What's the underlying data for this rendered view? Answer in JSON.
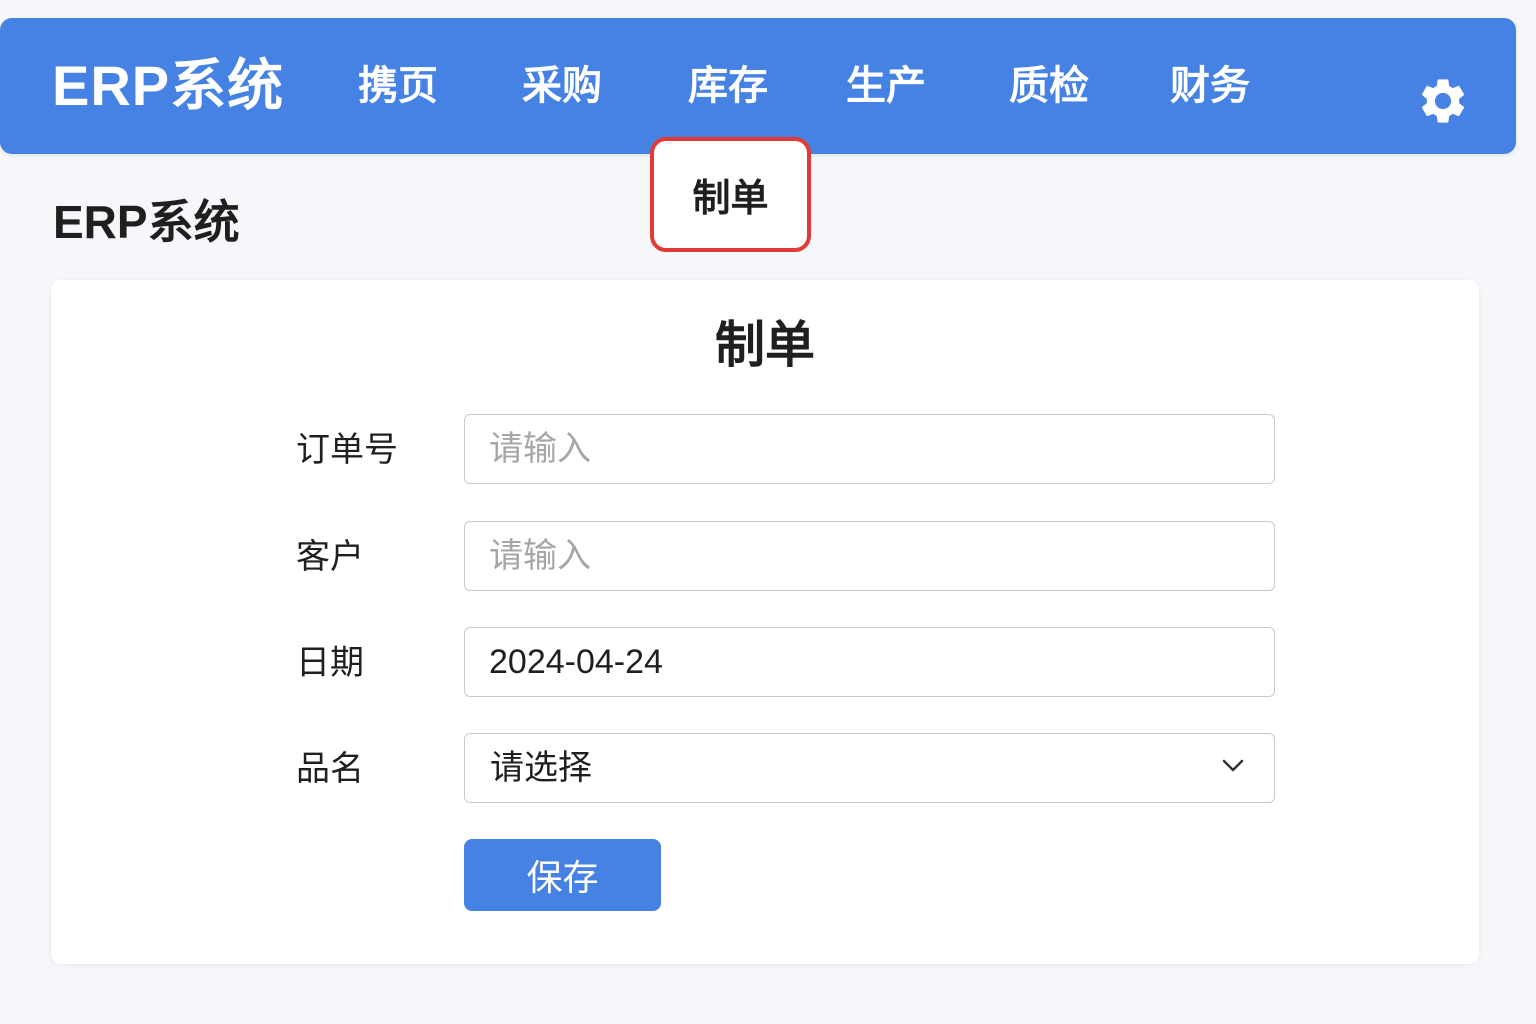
{
  "app": {
    "brand": "ERP系统",
    "page_title": "ERP系统"
  },
  "nav": {
    "items": [
      {
        "label": "携页"
      },
      {
        "label": "采购"
      },
      {
        "label": "库存"
      },
      {
        "label": "生产"
      },
      {
        "label": "质检"
      },
      {
        "label": "财务"
      }
    ],
    "settings_icon": "gear-icon",
    "active_item": "库存",
    "dropdown_item": "制单"
  },
  "form": {
    "title": "制单",
    "fields": {
      "order_no": {
        "label": "订单号",
        "value": "",
        "placeholder": "请输入"
      },
      "customer": {
        "label": "客户",
        "value": "",
        "placeholder": "请输入"
      },
      "date": {
        "label": "日期",
        "value": "2024-04-24"
      },
      "product": {
        "label": "品名",
        "selected": "请选择"
      }
    },
    "save_label": "保存"
  },
  "colors": {
    "primary": "#4582e3",
    "highlight_border": "#e23b37",
    "background": "#f5f7fa"
  }
}
